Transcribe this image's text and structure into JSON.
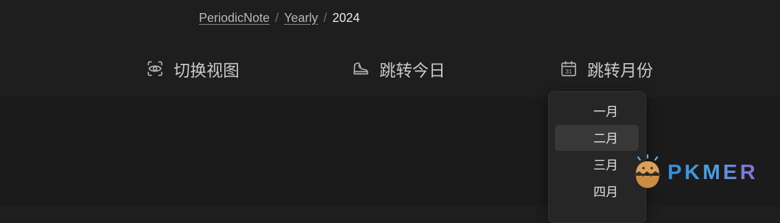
{
  "breadcrumb": {
    "items": [
      "PeriodicNote",
      "Yearly"
    ],
    "separator": "/",
    "current": "2024"
  },
  "toolbar": {
    "switch_view": {
      "label": "切换视图",
      "icon": "eye-icon"
    },
    "jump_today": {
      "label": "跳转今日",
      "icon": "sneaker-icon"
    },
    "jump_month": {
      "label": "跳转月份",
      "icon": "calendar-icon",
      "icon_text": "31"
    }
  },
  "month_menu": {
    "items": [
      "一月",
      "二月",
      "三月",
      "四月"
    ],
    "highlighted": "二月"
  },
  "watermark": {
    "text": "PKMER"
  },
  "colors": {
    "background": "#1e1e1e",
    "menu_background": "#262626",
    "menu_highlight": "#383838",
    "logo_gradient_start": "#2f8fe0",
    "logo_gradient_end": "#8a6fd8",
    "logo_egg": "#d9a15a"
  }
}
